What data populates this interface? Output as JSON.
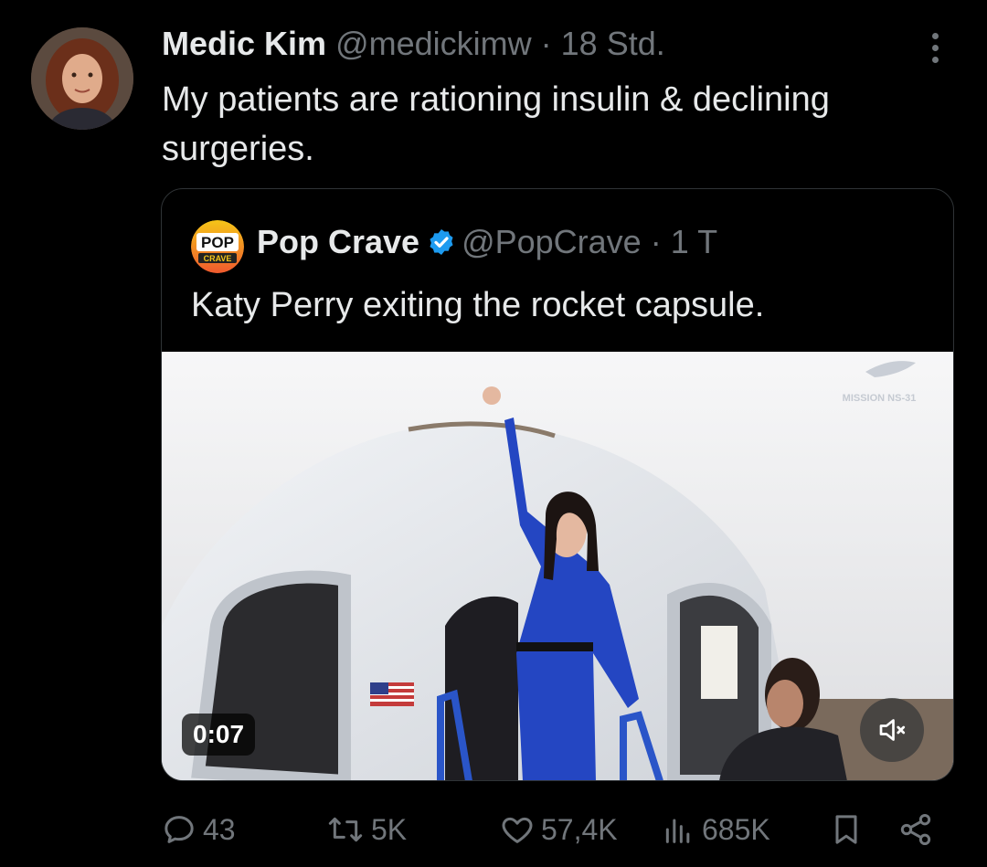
{
  "tweet": {
    "author_name": "Medic Kim",
    "handle": "@medickimw",
    "separator": "·",
    "time": "18 Std.",
    "text": "My patients are rationing insulin & declining surgeries."
  },
  "quote": {
    "author_name": "Pop Crave",
    "handle": "@PopCrave",
    "separator": "·",
    "time": "1 T",
    "text": "Katy Perry exiting the rocket capsule.",
    "logo_top": "POP",
    "logo_bottom": "CRAVE",
    "video": {
      "timestamp": "0:07",
      "overlay_text": "MISSION NS-31",
      "muted": true
    }
  },
  "actions": {
    "replies": "43",
    "reposts": "5K",
    "likes": "57,4K",
    "views": "685K"
  },
  "colors": {
    "background": "#000000",
    "text": "#e7e9ea",
    "muted": "#71767b",
    "verified": "#1d9bf0",
    "border": "#2f3336"
  },
  "icons": [
    "more-icon",
    "verified-badge-icon",
    "mute-icon",
    "reply-icon",
    "repost-icon",
    "like-icon",
    "views-icon",
    "bookmark-icon",
    "share-icon"
  ]
}
